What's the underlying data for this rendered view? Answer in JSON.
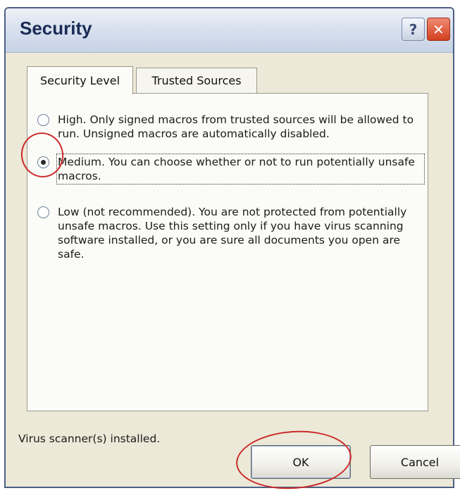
{
  "window": {
    "title": "Security",
    "help_icon": "question-mark-icon",
    "close_icon": "close-x-icon",
    "help_glyph": "?",
    "close_glyph": "✕"
  },
  "tabs": [
    {
      "label": "Security Level",
      "active": true
    },
    {
      "label": "Trusted Sources",
      "active": false
    }
  ],
  "security_levels": [
    {
      "label": "High. Only signed macros from trusted sources will be allowed to run. Unsigned macros are automatically disabled.",
      "checked": false
    },
    {
      "label": "Medium. You can choose whether or not to run potentially unsafe macros.",
      "checked": true
    },
    {
      "label": "Low (not recommended). You are not protected from potentially unsafe macros. Use this setting only if you have virus scanning software installed, or you are sure all documents you open are safe.",
      "checked": false
    }
  ],
  "status_text": "Virus scanner(s) installed.",
  "buttons": {
    "ok": "OK",
    "cancel": "Cancel"
  },
  "colors": {
    "annotation": "#cc2a2a",
    "window_bg": "#ece9d8",
    "close_button": "#d3401f"
  }
}
